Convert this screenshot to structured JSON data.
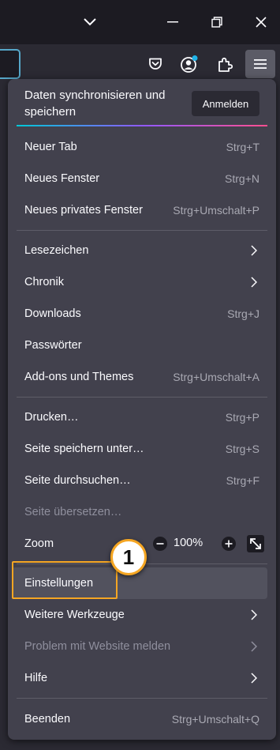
{
  "sync": {
    "title": "Daten synchronisieren und speichern",
    "login_button": "Anmelden"
  },
  "menu": {
    "items": [
      {
        "label": "Neuer Tab",
        "shortcut": "Strg+T"
      },
      {
        "label": "Neues Fenster",
        "shortcut": "Strg+N"
      },
      {
        "label": "Neues privates Fenster",
        "shortcut": "Strg+Umschalt+P"
      },
      {
        "label": "Lesezeichen"
      },
      {
        "label": "Chronik"
      },
      {
        "label": "Downloads",
        "shortcut": "Strg+J"
      },
      {
        "label": "Passwörter"
      },
      {
        "label": "Add-ons und Themes",
        "shortcut": "Strg+Umschalt+A"
      },
      {
        "label": "Drucken…",
        "shortcut": "Strg+P"
      },
      {
        "label": "Seite speichern unter…",
        "shortcut": "Strg+S"
      },
      {
        "label": "Seite durchsuchen…",
        "shortcut": "Strg+F"
      },
      {
        "label": "Seite übersetzen…"
      },
      {
        "label": "Einstellungen"
      },
      {
        "label": "Weitere Werkzeuge"
      },
      {
        "label": "Problem mit Website melden"
      },
      {
        "label": "Hilfe"
      },
      {
        "label": "Beenden",
        "shortcut": "Strg+Umschalt+Q"
      }
    ]
  },
  "zoom": {
    "label": "Zoom",
    "level": "100%"
  },
  "annotation": {
    "step": "1"
  },
  "colors": {
    "highlight": "#f5a623",
    "panel": "#42414d",
    "accent_dot": "#1fb3e8"
  }
}
